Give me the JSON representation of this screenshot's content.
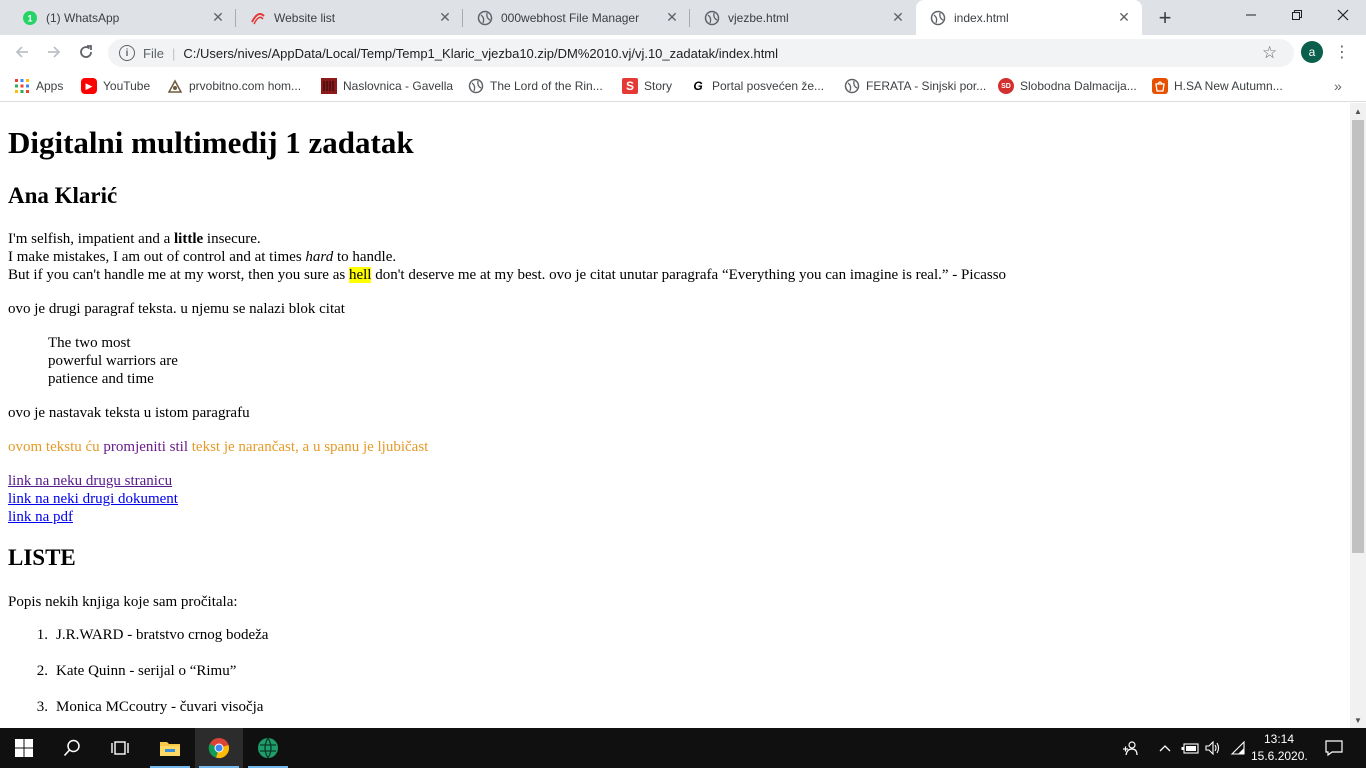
{
  "browser": {
    "tabs": [
      {
        "title": "(1) WhatsApp",
        "icon": "whatsapp-icon",
        "active": false
      },
      {
        "title": "Website list",
        "icon": "webhost-logo-icon",
        "active": false
      },
      {
        "title": "000webhost File Manager",
        "icon": "globe-icon",
        "active": false
      },
      {
        "title": "vjezbe.html",
        "icon": "globe-icon",
        "active": false
      },
      {
        "title": "index.html",
        "icon": "globe-icon",
        "active": true
      }
    ],
    "new_tab_label": "+",
    "address": {
      "scheme_label": "File",
      "url": "C:/Users/nives/AppData/Local/Temp/Temp1_Klaric_vjezba10.zip/DM%2010.vj/vj.10_zadatak/index.html"
    },
    "profile_initial": "a",
    "bookmarks": [
      {
        "label": "Apps",
        "icon": "apps-grid-icon",
        "color": "#4285f4"
      },
      {
        "label": "YouTube",
        "icon": "youtube-icon",
        "color": "#ff0000"
      },
      {
        "label": "prvobitno.com hom...",
        "icon": "site-icon",
        "color": "#6d5a3c"
      },
      {
        "label": "Naslovnica - Gavella",
        "icon": "gavella-icon",
        "color": "#8b1a1a"
      },
      {
        "label": "The Lord of the Rin...",
        "icon": "globe-icon",
        "color": "#5f6368"
      },
      {
        "label": "Story",
        "icon": "story-icon",
        "color": "#e53935"
      },
      {
        "label": "Portal posvećen že...",
        "icon": "portal-icon",
        "color": "#000000"
      },
      {
        "label": "FERATA - Sinjski por...",
        "icon": "globe-icon",
        "color": "#5f6368"
      },
      {
        "label": "Slobodna Dalmacija...",
        "icon": "sd-icon",
        "color": "#d32f2f"
      },
      {
        "label": "H.SA New Autumn...",
        "icon": "hsa-icon",
        "color": "#e65100"
      }
    ]
  },
  "page": {
    "h1": "Digitalni multimedij 1 zadatak",
    "h2_name": "Ana Klarić",
    "p1": {
      "l1_a": "I'm selfish, impatient and a ",
      "l1_bold": "little",
      "l1_b": " insecure.",
      "l2_a": "I make mistakes, I am out of control and at times ",
      "l2_italic": "hard",
      "l2_b": " to handle.",
      "l3_a": "But if you can't handle me at my worst, then you sure as ",
      "l3_mark": "hell",
      "l3_b": " don't deserve me at my best. ovo je citat unutar paragrafa “Everything you can imagine is real.” - Picasso"
    },
    "p2": "ovo je drugi paragraf teksta. u njemu se nalazi blok citat",
    "blockquote": [
      "The two most",
      "powerful warriors are",
      "patience and time"
    ],
    "p3": "ovo je nastavak teksta u istom paragrafu",
    "p4": {
      "a": "ovom tekstu ću ",
      "b": "promjeniti stil",
      "c": " tekst je narančast, a u spanu je ljubičast",
      "orange_color": "#e59a28",
      "purple_color": "#6a1b8a"
    },
    "links": [
      "link na neku drugu stranicu",
      "link na neki drugi dokument",
      "link na pdf"
    ],
    "h2_lists": "LISTE",
    "books_intro": "Popis nekih knjiga koje sam pročitala:",
    "books": [
      {
        "num": "1.",
        "text": "J.R.WARD - bratstvo crnog bodeža"
      },
      {
        "num": "2.",
        "text": "Kate Quinn - serijal o “Rimu”"
      },
      {
        "num": "3.",
        "text": "Monica MCcoutry - čuvari visočja"
      }
    ]
  },
  "taskbar": {
    "time": "13:14",
    "date": "15.6.2020."
  }
}
